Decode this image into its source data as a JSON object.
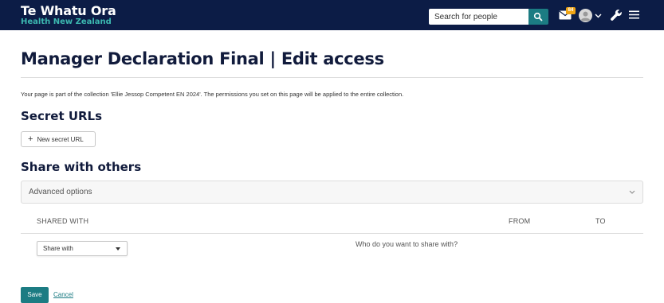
{
  "header": {
    "brand_main": "Te Whatu Ora",
    "brand_sub": "Health New Zealand",
    "search_placeholder": "Search for people",
    "notification_count": "84",
    "icons": [
      "search-icon",
      "mail-icon",
      "avatar-icon",
      "chevron-down-icon",
      "wrench-icon",
      "menu-icon"
    ]
  },
  "page": {
    "title": "Manager Declaration Final | Edit access",
    "intro": "Your page is part of the collection 'Ellie Jessop Competent EN 2024'. The permissions you set on this page will be applied to the entire collection."
  },
  "secret_urls": {
    "heading": "Secret URLs",
    "new_button": "New secret URL"
  },
  "share": {
    "heading": "Share with others",
    "advanced_label": "Advanced options",
    "columns": [
      "SHARED WITH",
      "FROM",
      "TO"
    ],
    "select_value": "Share with",
    "hint": "Who do you want to share with?"
  },
  "actions": {
    "save": "Save",
    "cancel": "Cancel"
  },
  "colors": {
    "header_bg": "#0c1c46",
    "brand_accent": "#3cb8b0",
    "primary": "#1c7c83",
    "title": "#111b3c",
    "badge": "#f0a515"
  }
}
